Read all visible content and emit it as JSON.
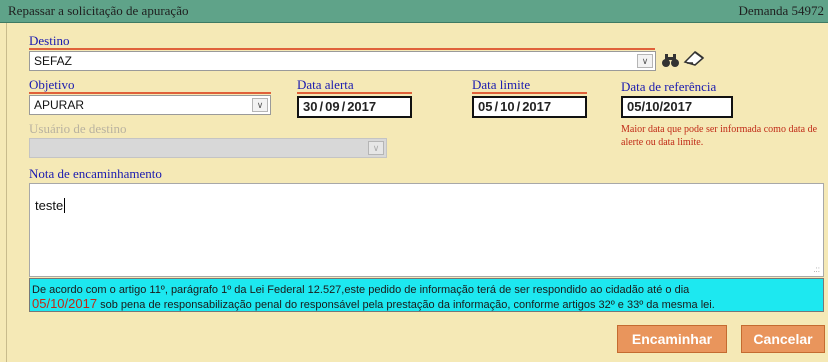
{
  "window": {
    "title": "Repassar a solicitação de apuração",
    "demanda": "Demanda 54972"
  },
  "destino": {
    "label": "Destino",
    "value": "SEFAZ"
  },
  "objetivo": {
    "label": "Objetivo",
    "value": "APURAR"
  },
  "data_alerta": {
    "label": "Data alerta",
    "day": "30",
    "month": "09",
    "year": "2017"
  },
  "data_limite": {
    "label": "Data limite",
    "day": "05",
    "month": "10",
    "year": "2017"
  },
  "data_referencia": {
    "label": "Data de referência",
    "value": "05/10/2017",
    "hint": "Maior data que pode ser informada como data de alerte ou data limite."
  },
  "usuario_destino": {
    "label": "Usuário de destino",
    "value": ""
  },
  "nota": {
    "label": "Nota de encaminhamento",
    "value": "teste"
  },
  "notice": {
    "line1": "De acordo com o artigo 11º, parágrafo 1º da Lei Federal 12.527,este pedido de informação terá de ser respondido ao cidadão até o dia",
    "date": "05/10/2017",
    "line2": " sob pena de responsabilização penal do responsável pela prestação da informação, conforme artigos 32º e 33º da mesma lei."
  },
  "buttons": {
    "encaminhar": "Encaminhar",
    "cancelar": "Cancelar"
  },
  "icons": [
    "binoculars-icon",
    "eraser-icon",
    "chevron-down-icon"
  ],
  "colors": {
    "background": "#f5e9b6",
    "titlebar": "#5fa389",
    "label": "#1a1ab0",
    "underline": "#e0613a",
    "button": "#e9955c",
    "notice": "#1de8f0",
    "hint": "#c02a16"
  }
}
